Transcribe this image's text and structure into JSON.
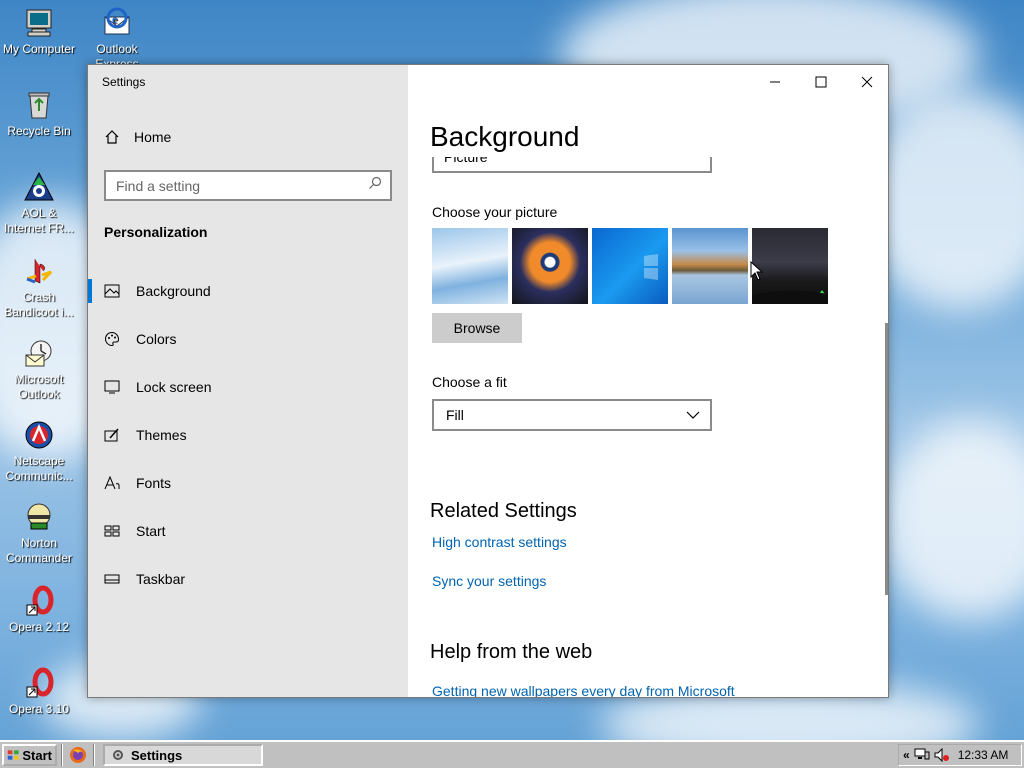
{
  "desktop": {
    "icons": [
      {
        "label": "My Computer",
        "icon": "computer-icon"
      },
      {
        "label": "Outlook Express",
        "icon": "outlook-express-icon"
      },
      {
        "label": "Recycle Bin",
        "icon": "recycle-bin-icon"
      },
      {
        "label": "AOL & Internet FR...",
        "icon": "aol-icon"
      },
      {
        "label": "Crash Bandicoot i...",
        "icon": "playstation-icon"
      },
      {
        "label": "Microsoft Outlook",
        "icon": "outlook-icon"
      },
      {
        "label": "Netscape Communic...",
        "icon": "netscape-icon"
      },
      {
        "label": "Norton Commander",
        "icon": "norton-commander-icon"
      },
      {
        "label": "Opera 2.12",
        "icon": "opera-icon"
      },
      {
        "label": "Opera 3.10",
        "icon": "opera-icon"
      }
    ]
  },
  "window": {
    "title": "Settings",
    "sidebar": {
      "home_label": "Home",
      "search_placeholder": "Find a setting",
      "section_label": "Personalization",
      "nav_items": [
        {
          "label": "Background",
          "icon": "picture-icon",
          "active": true
        },
        {
          "label": "Colors",
          "icon": "palette-icon",
          "active": false
        },
        {
          "label": "Lock screen",
          "icon": "lock-screen-icon",
          "active": false
        },
        {
          "label": "Themes",
          "icon": "themes-icon",
          "active": false
        },
        {
          "label": "Fonts",
          "icon": "fonts-icon",
          "active": false
        },
        {
          "label": "Start",
          "icon": "start-icon",
          "active": false
        },
        {
          "label": "Taskbar",
          "icon": "taskbar-icon",
          "active": false
        }
      ]
    },
    "main": {
      "page_title": "Background",
      "background_type_value": "Picture",
      "choose_picture_label": "Choose your picture",
      "browse_label": "Browse",
      "choose_fit_label": "Choose a fit",
      "fit_value": "Fill",
      "related_title": "Related Settings",
      "related_links": [
        "High contrast settings",
        "Sync your settings"
      ],
      "help_title": "Help from the web",
      "help_links": [
        "Getting new wallpapers every day from Microsoft"
      ]
    }
  },
  "taskbar": {
    "start_label": "Start",
    "task_label": "Settings",
    "clock": "12:33 AM",
    "tray_chevron": "«"
  },
  "colors": {
    "accent": "#0078d7",
    "link": "#0063b1",
    "sidebar_bg": "#e6e6e6",
    "taskbar_bg": "#c0c0c0"
  }
}
